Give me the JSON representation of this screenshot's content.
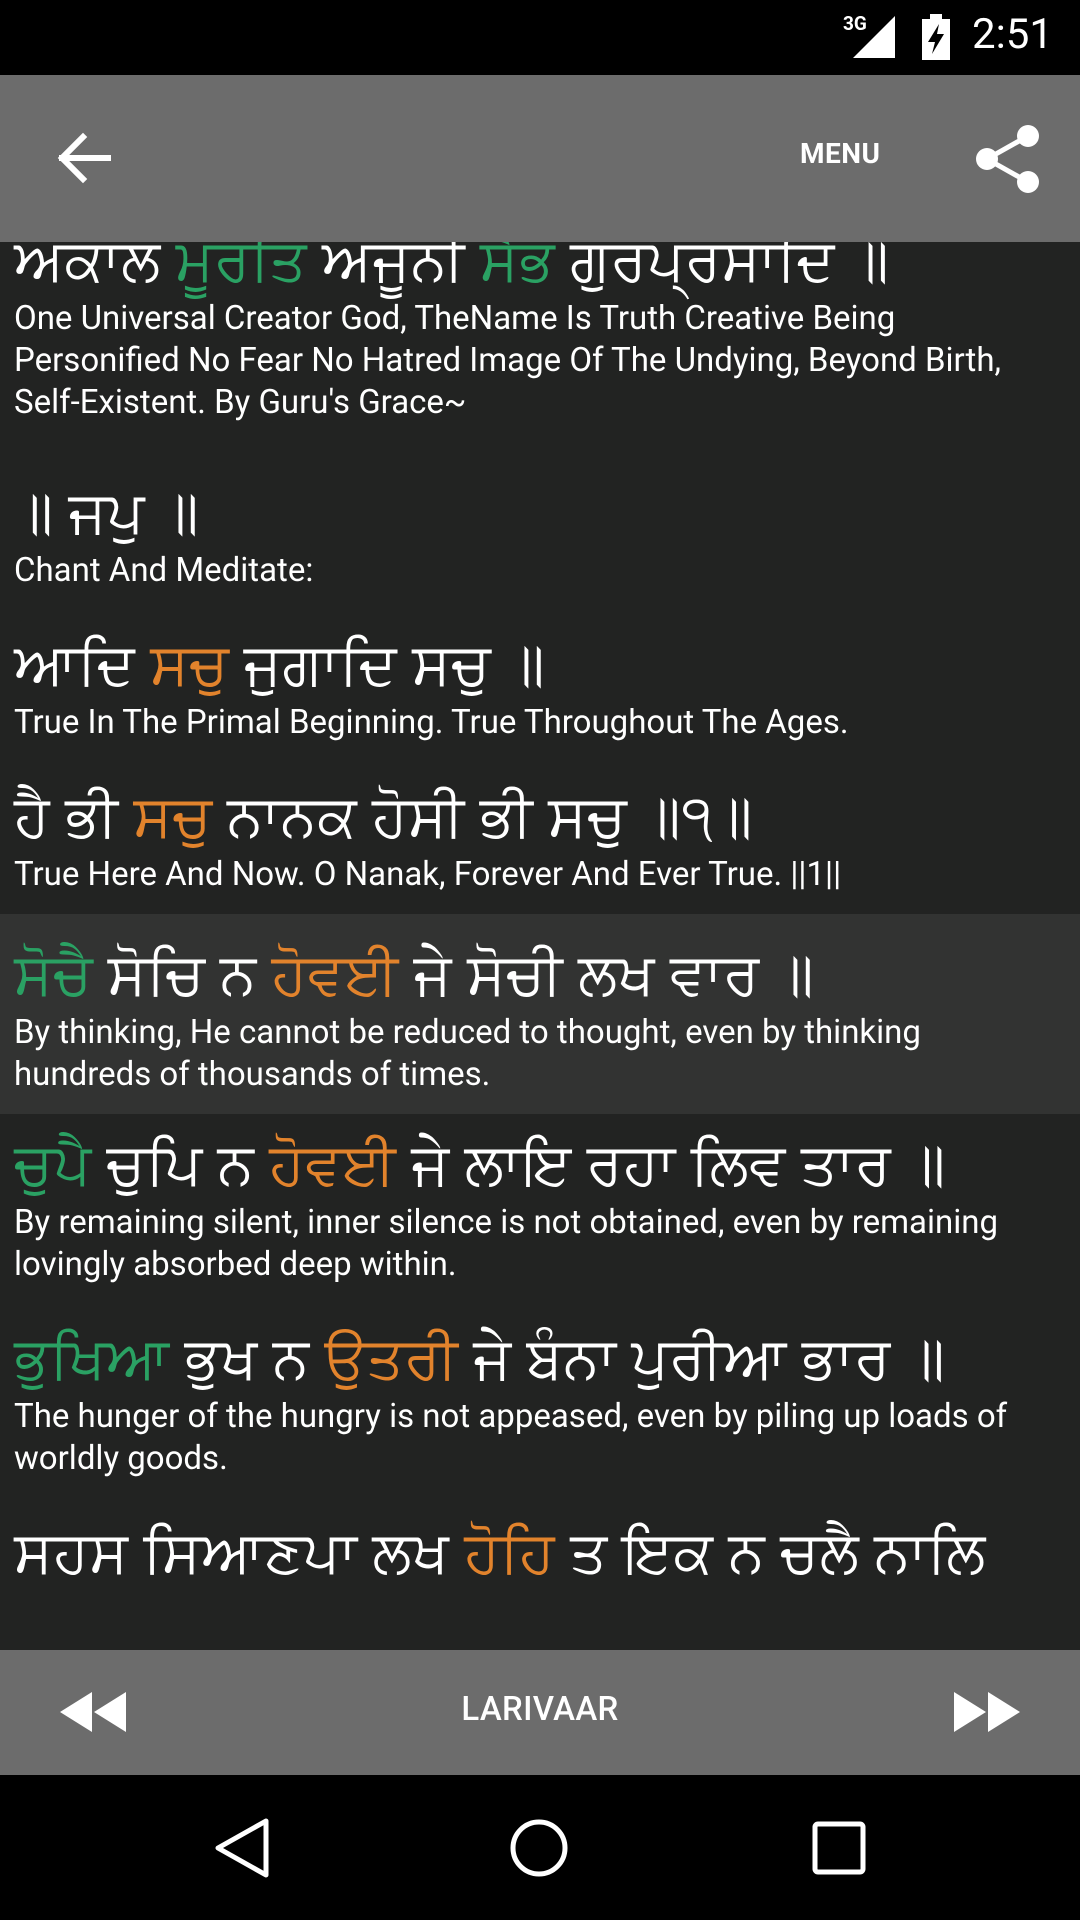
{
  "status_bar": {
    "network": "3G",
    "time": "2:51",
    "icons": [
      "signal-icon",
      "battery-charging-icon"
    ]
  },
  "app_bar": {
    "back_icon": "arrow-left-icon",
    "menu_label": "MENU",
    "share_icon": "share-icon"
  },
  "verses": [
    {
      "gurmukhi": [
        {
          "t": "ਅਕਾਲ ",
          "c": "w"
        },
        {
          "t": "ਮੂਰਤਿ",
          "c": "g"
        },
        {
          "t": " ਅਜੂਨੀ ",
          "c": "w"
        },
        {
          "t": "ਸੈਭੰ",
          "c": "g"
        },
        {
          "t": " ਗੁਰਪ੍ਰਸਾਦਿ ॥",
          "c": "w"
        }
      ],
      "translation": "One Universal Creator God, TheName Is Truth Creative Being Personified No Fear No Hatred Image Of The Undying, Beyond Birth, Self-Existent. By Guru's Grace~"
    },
    {
      "gurmukhi": [
        {
          "t": "॥ ਜਪੁ ॥",
          "c": "w"
        }
      ],
      "translation": "Chant And Meditate:"
    },
    {
      "gurmukhi": [
        {
          "t": "ਆਦਿ ",
          "c": "w"
        },
        {
          "t": "ਸਚੁ",
          "c": "o"
        },
        {
          "t": " ਜੁਗਾਦਿ ਸਚੁ ॥",
          "c": "w"
        }
      ],
      "translation": "True In The Primal Beginning. True Throughout The Ages."
    },
    {
      "gurmukhi": [
        {
          "t": "ਹੈ ਭੀ ",
          "c": "w"
        },
        {
          "t": "ਸਚੁ",
          "c": "o"
        },
        {
          "t": " ਨਾਨਕ ਹੋਸੀ ਭੀ ਸਚੁ ॥੧॥",
          "c": "w"
        }
      ],
      "translation": "True Here And Now. O Nanak, Forever And Ever True. ||1||"
    },
    {
      "gurmukhi": [
        {
          "t": "ਸੋਚੈ",
          "c": "g"
        },
        {
          "t": " ਸੋਚਿ ਨ ",
          "c": "w"
        },
        {
          "t": "ਹੋਵਈ",
          "c": "o"
        },
        {
          "t": " ਜੇ ਸੋਚੀ ਲਖ ਵਾਰ ॥",
          "c": "w"
        }
      ],
      "translation": "By thinking, He cannot be reduced to thought, even by thinking hundreds of thousands of times.",
      "highlighted": true
    },
    {
      "gurmukhi": [
        {
          "t": "ਚੁਪੈ",
          "c": "g"
        },
        {
          "t": " ਚੁਪਿ ਨ ",
          "c": "w"
        },
        {
          "t": "ਹੋਵਈ",
          "c": "o"
        },
        {
          "t": " ਜੇ ਲਾਇ ਰਹਾ ਲਿਵ ਤਾਰ ॥",
          "c": "w"
        }
      ],
      "translation": "By remaining silent, inner silence is not obtained, even by remaining lovingly absorbed deep within."
    },
    {
      "gurmukhi": [
        {
          "t": "ਭੁਖਿਆ",
          "c": "g"
        },
        {
          "t": " ਭੁਖ ਨ ",
          "c": "w"
        },
        {
          "t": "ਉਤਰੀ",
          "c": "o"
        },
        {
          "t": " ਜੇ ਬੰਨਾ ਪੁਰੀਆ ਭਾਰ ॥",
          "c": "w"
        }
      ],
      "translation": "The hunger of the hungry is not appeased, even by piling up loads of worldly goods."
    },
    {
      "gurmukhi": [
        {
          "t": "ਸਹਸ ਸਿਆਣਪਾ ਲਖ ",
          "c": "w"
        },
        {
          "t": "ਹੋਹਿ",
          "c": "o"
        },
        {
          "t": " ਤ ਇਕ ਨ ਚਲੈ ਨਾਲਿ",
          "c": "w"
        }
      ],
      "translation": ""
    }
  ],
  "colors": {
    "green_word": "#2aa163",
    "orange_word": "#e2832c",
    "background": "#222322",
    "highlight_row": "#323332",
    "bar": "#6c6c6c"
  },
  "bottom_bar": {
    "rewind_icon": "rewind-icon",
    "larivaar_label": "LARIVAAR",
    "forward_icon": "fast-forward-icon"
  },
  "nav_bar": {
    "icons": [
      "nav-back-icon",
      "nav-home-icon",
      "nav-recents-icon"
    ]
  }
}
